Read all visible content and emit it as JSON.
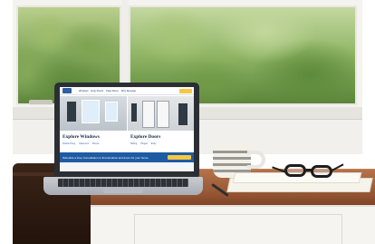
{
  "scene": {
    "description_colors": {
      "wood_desk": "#9a5a36",
      "site_brand_blue": "#1f5ba3",
      "site_cta_yellow": "#f6c744"
    }
  },
  "website": {
    "nav_links": [
      "Windows",
      "Entry Doors",
      "Patio Doors",
      "Why Renewal"
    ],
    "sections": [
      {
        "title": "Explore Windows",
        "links": [
          "Double-Hung",
          "Casement",
          "Picture"
        ]
      },
      {
        "title": "Explore Doors",
        "links": [
          "Sliding",
          "Hinged",
          "Entry"
        ]
      }
    ],
    "promo_text": "Schedule a Free Consultation to find windows and doors for your home."
  },
  "icons": {
    "logo": "brand-logo-icon"
  }
}
